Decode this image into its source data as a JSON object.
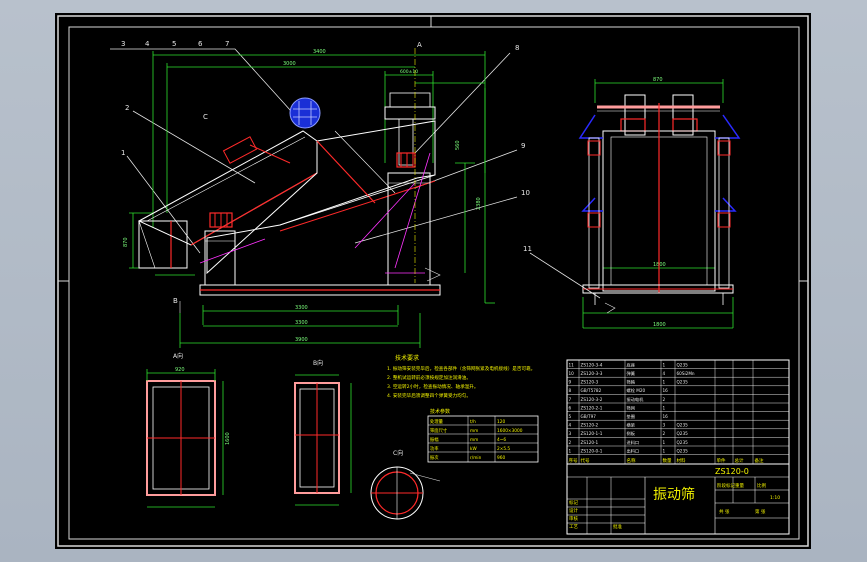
{
  "balloons_top": [
    "3",
    "4",
    "5",
    "6",
    "7"
  ],
  "balloons_right": [
    "8"
  ],
  "balloon_labels": {
    "b2": "2",
    "b1": "1",
    "b9": "9",
    "b10": "10",
    "b11": "11",
    "sectionC": "C",
    "sectionA": "A",
    "sectionB": "B"
  },
  "dims": {
    "d_top_outer": "3400",
    "d_top_inner": "3000",
    "d_top_small": "600±10",
    "d_bottom_a": "3300",
    "d_bottom_b": "3300",
    "d_bottom_c": "3900",
    "d_height_left": "870",
    "d_height_right": "2380",
    "d_side_right": "560",
    "d_side_top": "870",
    "d_side_bottom": "1800",
    "d_side_base": "1800",
    "d_plan_width": "920",
    "d_plan_len": "1600"
  },
  "view_labels": {
    "view_a": "A向",
    "view_b": "B向",
    "view_c": "C向"
  },
  "tech_requirements": {
    "title": "技术要求",
    "lines": [
      "1. 振动筛安装完毕后，检查各部件（含筛网张紧及电机接线）是否可靠。",
      "2. 整机试运转前必须按规定加注润滑油。",
      "3. 空运转2小时，检查振动情况、轴承温升。",
      "4. 安装完毕后须调整四个弹簧受力均匀。"
    ]
  },
  "params_table": {
    "title": "技术参数",
    "rows": [
      [
        "处理量",
        "t/h",
        "120"
      ],
      [
        "筛面尺寸",
        "mm",
        "1600×3000"
      ],
      [
        "振幅",
        "mm",
        "4~6"
      ],
      [
        "功率",
        "kW",
        "2×5.5"
      ],
      [
        "振次",
        "r/min",
        "960"
      ]
    ]
  },
  "parts_list": [
    [
      "11",
      "ZS120-3-4",
      "底座",
      "1",
      "Q235",
      "",
      "",
      ""
    ],
    [
      "10",
      "ZS120-3-3",
      "弹簧",
      "4",
      "60Si2Mn",
      "",
      "",
      ""
    ],
    [
      "9",
      "ZS120-3",
      "筛箱",
      "1",
      "Q235",
      "",
      "",
      ""
    ],
    [
      "8",
      "GB/T5782",
      "螺栓 M20",
      "16",
      "",
      "",
      "",
      ""
    ],
    [
      "7",
      "ZS120-3-2",
      "振动电机",
      "2",
      "",
      "",
      "",
      ""
    ],
    [
      "6",
      "ZS120-2-1",
      "筛网",
      "1",
      "",
      "",
      "",
      ""
    ],
    [
      "5",
      "GB/T97",
      "垫圈",
      "16",
      "",
      "",
      "",
      ""
    ],
    [
      "4",
      "ZS120-2",
      "横梁",
      "3",
      "Q235",
      "",
      "",
      ""
    ],
    [
      "3",
      "ZS120-1-1",
      "侧板",
      "2",
      "Q235",
      "",
      "",
      ""
    ],
    [
      "2",
      "ZS120-1",
      "进料口",
      "1",
      "Q235",
      "",
      "",
      ""
    ],
    [
      "1",
      "ZS120-0-1",
      "出料口",
      "1",
      "Q235",
      "",
      "",
      ""
    ]
  ],
  "parts_header": [
    "序号",
    "代号",
    "名称",
    "数量",
    "材料",
    "单件",
    "总计",
    "备注"
  ],
  "title_block": {
    "drawing_no": "ZS120-0",
    "name": "振动筛",
    "rows_left": [
      "标记",
      "设计",
      "审核",
      "工艺",
      "批准"
    ],
    "rows_right": [
      "阶段标记",
      "重量",
      "比例",
      "共 张",
      "第 张"
    ],
    "scale": "1:10"
  },
  "colors": {
    "frame": "#e6e6e6",
    "dim": "#2ee02e",
    "part": "#ffffff",
    "red": "#ff2a2a",
    "magenta": "#ff33ff",
    "yellow": "#f2f200",
    "blue": "#2a2aff",
    "cyan": "#22d3ee"
  }
}
